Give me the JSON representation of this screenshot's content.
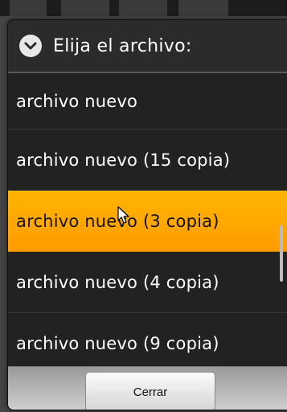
{
  "dialog": {
    "title": "Elija el archivo:",
    "title_icon": "chevron-down-circle-icon",
    "items": [
      {
        "label": "archivo nuevo",
        "selected": false
      },
      {
        "label": "archivo nuevo (15 copia)",
        "selected": false
      },
      {
        "label": "archivo nuevo (3 copia)",
        "selected": true
      },
      {
        "label": "archivo nuevo (4 copia)",
        "selected": false
      },
      {
        "label": "archivo nuevo (9 copia)",
        "selected": false
      }
    ],
    "close_button": "Cerrar"
  },
  "colors": {
    "selection": "#ffa800",
    "title_bar": "#2b2b2b",
    "list_bg": "#222222"
  }
}
